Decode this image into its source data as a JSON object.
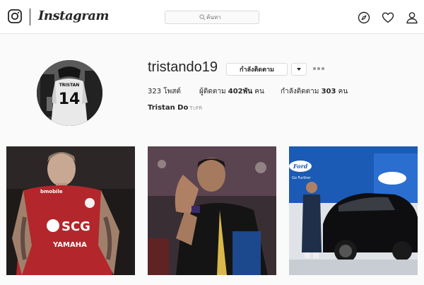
{
  "app": {
    "name": "Instagram"
  },
  "search": {
    "placeholder": "ค้นหา"
  },
  "nav": {
    "icons": [
      "compass-icon",
      "heart-icon",
      "person-icon"
    ]
  },
  "profile": {
    "username": "tristando19",
    "follow_label": "กำลังติดตาม",
    "stats": {
      "posts_count": "323",
      "posts_label": "โพสต์",
      "followers_label": "ผู้ติดตาม",
      "followers_count": "402พัน",
      "followers_unit": "คน",
      "following_label": "กำลังติดตาม",
      "following_count": "303",
      "following_unit": "คน"
    },
    "full_name": "Tristan Do",
    "full_name_suffix": "T▫FR",
    "avatar_jersey": {
      "name": "TRISTAN",
      "number": "14"
    }
  },
  "posts": [
    {
      "sponsor": "SCG",
      "sponsor2": "YAMAHA",
      "top_text": "bmobile"
    },
    {
      "scene": "coach-applauding"
    },
    {
      "banner_brand": "Ford",
      "banner_tagline": "Go Further"
    }
  ],
  "colors": {
    "text": "#262626",
    "border": "#dbdbdb",
    "background": "#fafafa",
    "jersey_red": "#b3262b"
  }
}
